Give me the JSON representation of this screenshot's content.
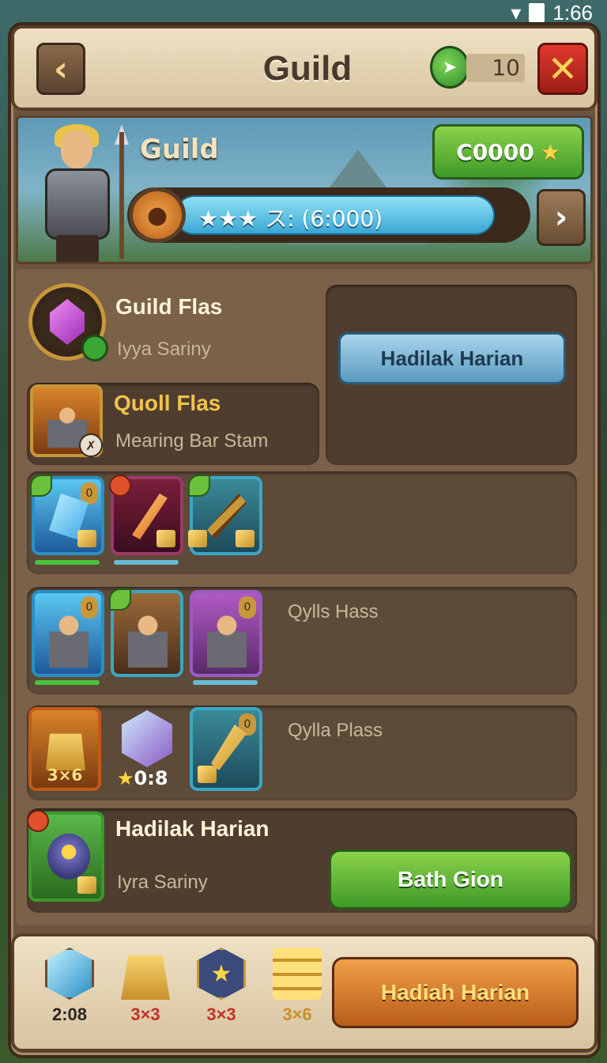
{
  "status_bar": {
    "time": "1:66"
  },
  "header": {
    "title": "Guild",
    "ticket_count": "10"
  },
  "banner": {
    "guild_name": "Guild",
    "coin_amount": "C0000",
    "progress_label": "★★★ ス: (6:000)",
    "progress_fraction": 0.92
  },
  "guild_row": {
    "title": "Guild Flas",
    "subtitle": "Iyya Sariny"
  },
  "daily_button": {
    "label": "Hadilak Harian"
  },
  "member_row": {
    "title": "Quoll Flas",
    "subtitle": "Mearing Bar Stam"
  },
  "item_rows": [
    {
      "label": ""
    },
    {
      "label": "Qylls Hass"
    },
    {
      "label": "Qylla Plass",
      "crystal_value": "0:8",
      "gold_qty": "3×6"
    }
  ],
  "quest_row": {
    "title": "Hadilak Harian",
    "subtitle": "Iyra Sariny",
    "button_label": "Bath Gion"
  },
  "footer": {
    "rewards": [
      {
        "icon": "blue-crystal-icon",
        "label": "2:08",
        "color": "#2a2620"
      },
      {
        "icon": "gold-bars-icon",
        "label": "3×3",
        "color": "#c8302a"
      },
      {
        "icon": "star-shield-icon",
        "label": "3×3",
        "color": "#c8302a"
      },
      {
        "icon": "gold-stack-icon",
        "label": "3×6",
        "color": "#c8902a"
      }
    ],
    "claim_button": "Hadiah Harian"
  }
}
